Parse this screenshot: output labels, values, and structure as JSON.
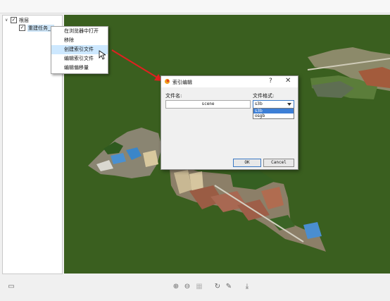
{
  "tree": {
    "root_label": "根层",
    "child_label": "重建任务_7",
    "root_checked": "✓",
    "child_checked": "✓"
  },
  "context_menu": {
    "items": [
      "在浏览器中打开",
      "移除",
      "创建索引文件",
      "编辑索引文件",
      "编辑偏移量"
    ],
    "active_index": 2
  },
  "dialog": {
    "title": "索引编辑",
    "help": "?",
    "close": "✕",
    "filename_label": "文件名:",
    "filename_value": "scene",
    "format_label": "文件格式:",
    "format_selected": "s3b",
    "format_options": [
      "s3b",
      "osgb"
    ],
    "ok_label": "OK",
    "cancel_label": "Cancel"
  },
  "colors": {
    "viewport_bg": "#3a5f1f",
    "accent": "#3b79c4",
    "arrow": "#e02020"
  },
  "toolbar_icons": [
    "screenshot-icon",
    "zoom-in-icon",
    "zoom-out-icon",
    "fit-icon",
    "rotate-icon",
    "edit-icon",
    "download-icon"
  ]
}
